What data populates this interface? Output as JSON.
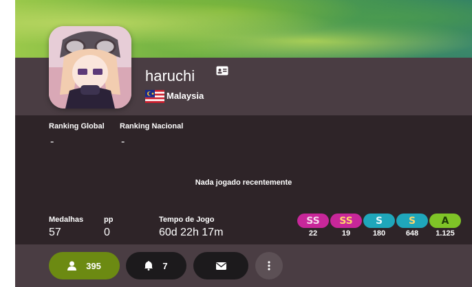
{
  "user": {
    "username": "haruchi",
    "country": "Malaysia",
    "avatar_icon": "anime-avatar"
  },
  "ranks": {
    "global_label": "Ranking Global",
    "global_value": "-",
    "national_label": "Ranking Nacional",
    "national_value": "-"
  },
  "recent": {
    "message": "Nada jogado recentemente"
  },
  "stats": {
    "medals_label": "Medalhas",
    "medals_value": "57",
    "pp_label": "pp",
    "pp_value": "0",
    "playtime_label": "Tempo de Jogo",
    "playtime_value": "60d 22h 17m"
  },
  "grades": [
    {
      "label": "SS",
      "count": "22",
      "color": "#c8279a",
      "text_color": "#f3d7ea"
    },
    {
      "label": "SS",
      "count": "19",
      "color": "#c8279a",
      "text_color": "#ffd56a"
    },
    {
      "label": "S",
      "count": "180",
      "color": "#1fa7bb",
      "text_color": "#e6f7fa"
    },
    {
      "label": "S",
      "count": "648",
      "color": "#1fa7bb",
      "text_color": "#ffd56a"
    },
    {
      "label": "A",
      "count": "1.125",
      "color": "#7fc427",
      "text_color": "#1f3b07"
    }
  ],
  "footer": {
    "friends_count": "395",
    "notifications_count": "7",
    "friends_color": "#6c8a12",
    "icons": [
      "user-icon",
      "bell-icon",
      "mail-icon",
      "more-vertical-icon"
    ]
  }
}
